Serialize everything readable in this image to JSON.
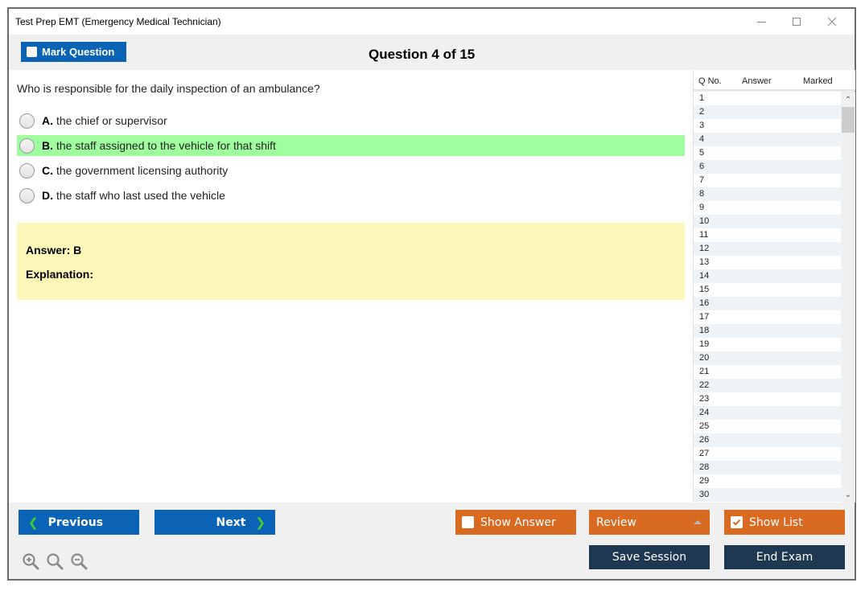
{
  "window": {
    "title": "Test Prep EMT (Emergency Medical Technician)"
  },
  "header": {
    "mark_label": "Mark Question",
    "question_counter": "Question 4 of 15"
  },
  "question": {
    "text": "Who is responsible for the daily inspection of an ambulance?",
    "options": [
      {
        "letter": "A.",
        "text": "the chief or supervisor",
        "correct": false
      },
      {
        "letter": "B.",
        "text": "the staff assigned to the vehicle for that shift",
        "correct": true
      },
      {
        "letter": "C.",
        "text": "the government licensing authority",
        "correct": false
      },
      {
        "letter": "D.",
        "text": "the staff who last used the vehicle",
        "correct": false
      }
    ],
    "answer_label": "Answer: B",
    "explanation_label": "Explanation:"
  },
  "question_list": {
    "columns": [
      "Q No.",
      "Answer",
      "Marked"
    ],
    "rows": [
      "1",
      "2",
      "3",
      "4",
      "5",
      "6",
      "7",
      "8",
      "9",
      "10",
      "11",
      "12",
      "13",
      "14",
      "15",
      "16",
      "17",
      "18",
      "19",
      "20",
      "21",
      "22",
      "23",
      "24",
      "25",
      "26",
      "27",
      "28",
      "29",
      "30"
    ]
  },
  "footer": {
    "previous_label": "Previous",
    "next_label": "Next",
    "show_answer_label": "Show Answer",
    "show_answer_checked": false,
    "review_label": "Review",
    "show_list_label": "Show List",
    "show_list_checked": true,
    "save_session_label": "Save Session",
    "end_exam_label": "End Exam"
  },
  "colors": {
    "primary_blue": "#0b63b6",
    "orange": "#d96a21",
    "dark_navy": "#1d3850",
    "correct_green": "#9ffe9d",
    "answer_yellow": "#fdf8b8",
    "chevron_green": "#3fd02f"
  }
}
